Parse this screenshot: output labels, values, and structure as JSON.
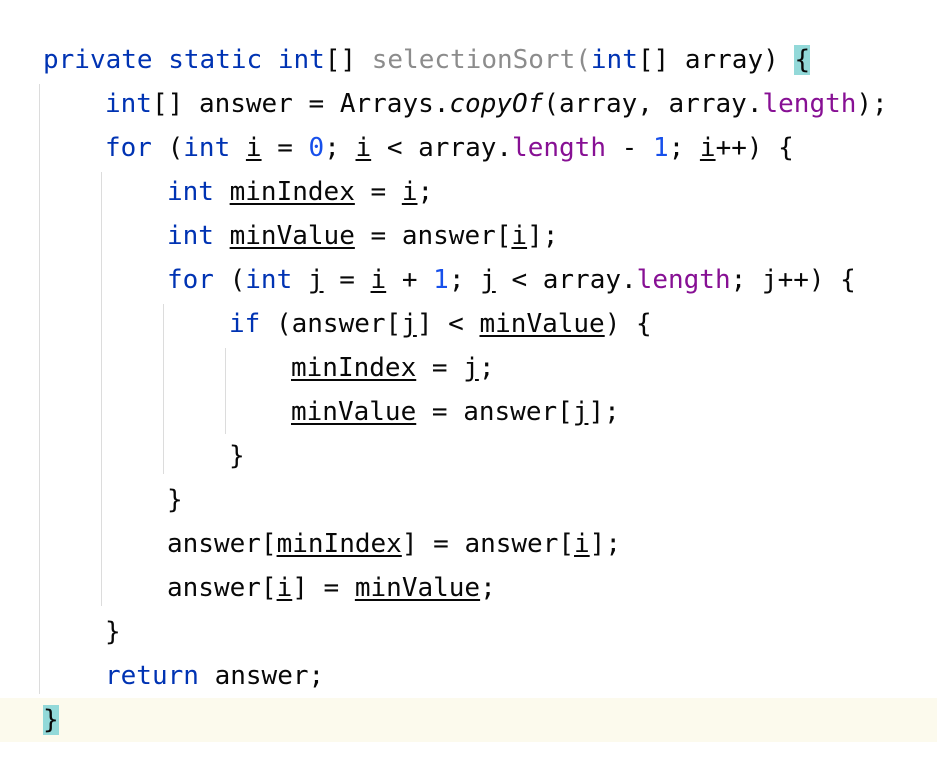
{
  "code": {
    "kw_private": "private",
    "kw_static": "static",
    "kw_int": "int",
    "brackets": "[]",
    "method_name": "selectionSort",
    "open_paren": "(",
    "param": "array",
    "close_paren_brace": ")",
    "open_brace": "{",
    "close_brace": "}",
    "answer": "answer",
    "equals": "=",
    "arrays": "Arrays.",
    "copy_of": "copyOf",
    "array_comma": "(array, array.",
    "length": "length",
    "stmt_end": ");",
    "kw_for": "for",
    "i_var": "i",
    "j_var": "j",
    "zero": "0",
    "one": "1",
    "less_than": "<",
    "array_dot": "array.",
    "minus": "-",
    "plus": "+",
    "incr_end": "++) {",
    "semicolon": ";",
    "min_index": "minIndex",
    "min_value": "minValue",
    "kw_if": "if",
    "answer_bracket_open": "answer[",
    "bracket_close": "]",
    "bracket_close_semicolon": "];",
    "kw_return": "return",
    "return_value": "answer;"
  },
  "colors": {
    "keyword": "#0033b3",
    "number": "#1750eb",
    "field": "#871094",
    "unused_method_name": "#8c8c8c",
    "matched_brace_highlight": "#93d9d9",
    "current_line_background": "#fcfaed"
  }
}
